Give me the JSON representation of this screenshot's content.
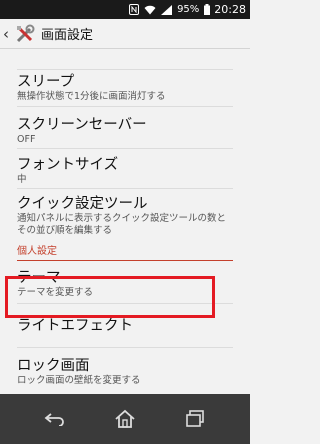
{
  "status_bar": {
    "battery_percent": "95%",
    "time": "20:28",
    "icons": [
      "nfc-icon",
      "wifi-icon",
      "signal-icon",
      "battery-icon"
    ]
  },
  "action_bar": {
    "title": "画面設定",
    "icons": [
      "back-icon",
      "settings-tools-icon"
    ]
  },
  "settings": {
    "items": [
      {
        "label": "スリープ",
        "sub": "無操作状態で1分後に画面消灯する"
      },
      {
        "label": "スクリーンセーバー",
        "sub": "OFF"
      },
      {
        "label": "フォントサイズ",
        "sub": "中"
      },
      {
        "label": "クイック設定ツール",
        "sub": "通知パネルに表示するクイック設定ツールの数とその並び順を編集する"
      }
    ],
    "section_header": "個人設定",
    "personal_items": [
      {
        "label": "テーマ",
        "sub": "テーマを変更する"
      },
      {
        "label": "ライトエフェクト",
        "sub": ""
      },
      {
        "label": "ロック画面",
        "sub": "ロック画面の壁紙を変更する"
      }
    ]
  },
  "nav_bar": {
    "icons": [
      "nav-back-icon",
      "nav-home-icon",
      "nav-recents-icon"
    ]
  },
  "colors": {
    "accent": "#c4402c",
    "highlight": "#e41b23",
    "background": "#f2f2f2",
    "navbar": "#3a3a3a"
  }
}
